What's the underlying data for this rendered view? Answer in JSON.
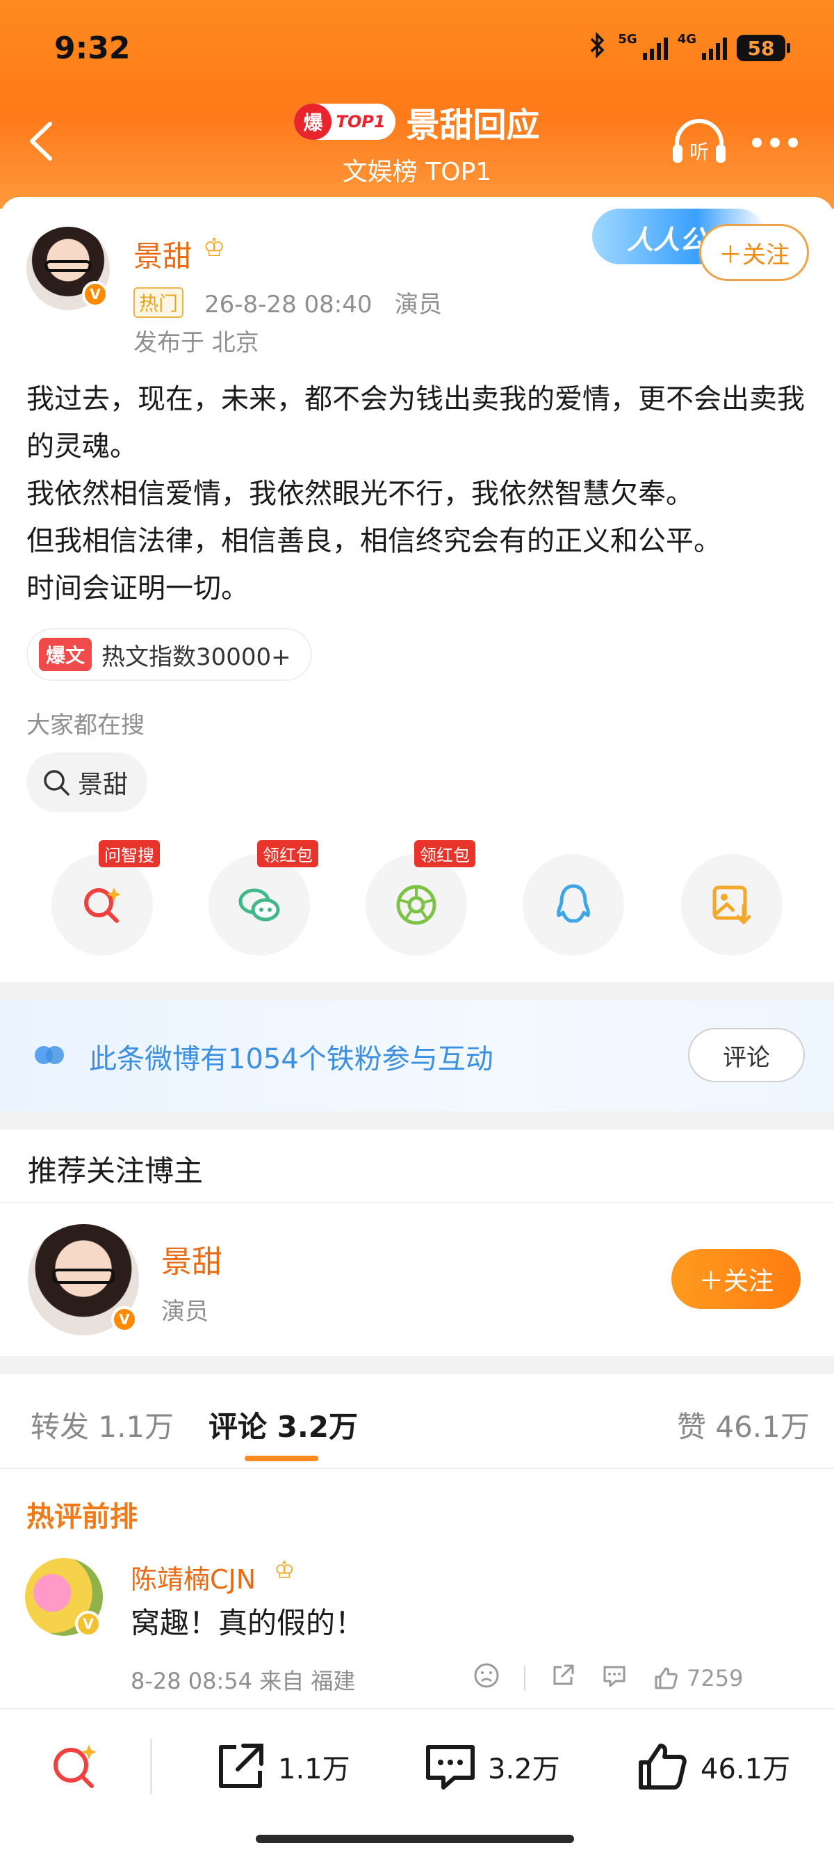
{
  "status_bar": {
    "time": "9:32",
    "battery": "58",
    "net1": "5G",
    "net2": "4G"
  },
  "header": {
    "badge_bao": "爆",
    "badge_top": "TOP1",
    "title": "景甜回应",
    "subtitle": "文娱榜 TOP1",
    "listen_label": "听"
  },
  "post": {
    "author": "景甜",
    "hot_tag": "热门",
    "meta": "26-8-28 08:40   演员",
    "location": "发布于 北京",
    "banner_text": "人人公",
    "follow_label": "关注",
    "body": "我过去，现在，未来，都不会为钱出卖我的爱情，更不会出卖我的灵魂。\n我依然相信爱情，我依然眼光不行，我依然智慧欠奉。\n但我相信法律，相信善良，相信终究会有的正义和公平。\n时间会证明一切。",
    "hot_index_tag": "爆文",
    "hot_index": "热文指数30000+",
    "search_label": "大家都在搜",
    "search_chip": "景甜"
  },
  "share": [
    {
      "name": "ask-search",
      "badge": "问智搜",
      "color": "#f0413f"
    },
    {
      "name": "wechat",
      "badge": "领红包",
      "color": "#41b88a"
    },
    {
      "name": "moments",
      "badge": "领红包",
      "color": "#7cc244"
    },
    {
      "name": "qq",
      "badge": "",
      "color": "#3ea6e6"
    },
    {
      "name": "save-image",
      "badge": "",
      "color": "#f3a72b"
    }
  ],
  "fans": {
    "text": "此条微博有1054个铁粉参与互动",
    "button": "评论"
  },
  "recommend": {
    "title": "推荐关注博主",
    "name": "景甜",
    "sub": "演员",
    "follow_label": "关注"
  },
  "tabs": {
    "repost": "转发 1.1万",
    "comment": "评论 3.2万",
    "like": "赞 46.1万"
  },
  "comment": {
    "section_title": "热评前排",
    "name": "陈靖楠CJN",
    "text": "窝趣！真的假的！",
    "meta": "8-28 08:54 来自 福建",
    "likes": "7259"
  },
  "bottom_bar": {
    "repost": "1.1万",
    "comment": "3.2万",
    "like": "46.1万"
  }
}
